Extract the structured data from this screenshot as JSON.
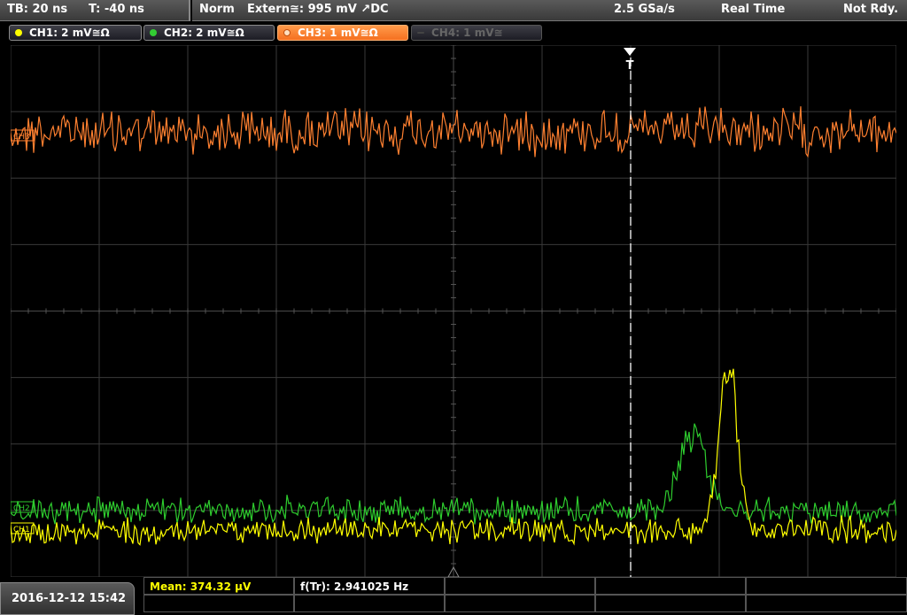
{
  "header": {
    "timebase": "TB: 20 ns",
    "time_offset": "T: -40 ns",
    "trigger_mode": "Norm",
    "trigger_source": "Extern≅: 995 mV ↗DC",
    "sample_rate": "2.5 GSa/s",
    "acq_mode": "Real Time",
    "status": "Not Rdy."
  },
  "channels": [
    {
      "label": "CH1: 2 mV≅Ω",
      "color": "#ffff00",
      "state": "on"
    },
    {
      "label": "CH2: 2 mV≅Ω",
      "color": "#33cc33",
      "state": "on"
    },
    {
      "label": "CH3: 1 mV≅Ω",
      "color": "#ff8030",
      "state": "active"
    },
    {
      "label": "CH4: 1 mV≅",
      "color": "#555555",
      "state": "off"
    }
  ],
  "markers": {
    "ch3": "CH3",
    "ch2": "CH2",
    "ch1": "CH1",
    "trigger": "T"
  },
  "footer": {
    "datetime": "2016-12-12 15:42",
    "mean": "Mean: 374.32 µV",
    "freq": "f(Tr): 2.941025 Hz"
  },
  "colors": {
    "ch1": "#ffff00",
    "ch2": "#2ecc2e",
    "ch3": "#ff8030",
    "grid": "#3a3a3a"
  },
  "chart_data": {
    "type": "line",
    "title": "",
    "divisions_x": 10,
    "divisions_y": 8,
    "trigger_position_div": 7,
    "series": [
      {
        "name": "CH3",
        "baseline_div": 1.3,
        "noise_div": 0.5,
        "pulse": null
      },
      {
        "name": "CH2",
        "baseline_div": 7.0,
        "noise_div": 0.3,
        "pulse": {
          "center_div": 7.7,
          "height_div": 1.2,
          "width_div": 0.3
        }
      },
      {
        "name": "CH1",
        "baseline_div": 7.3,
        "noise_div": 0.3,
        "pulse": {
          "center_div": 8.1,
          "height_div": 2.6,
          "width_div": 0.2
        }
      }
    ]
  }
}
